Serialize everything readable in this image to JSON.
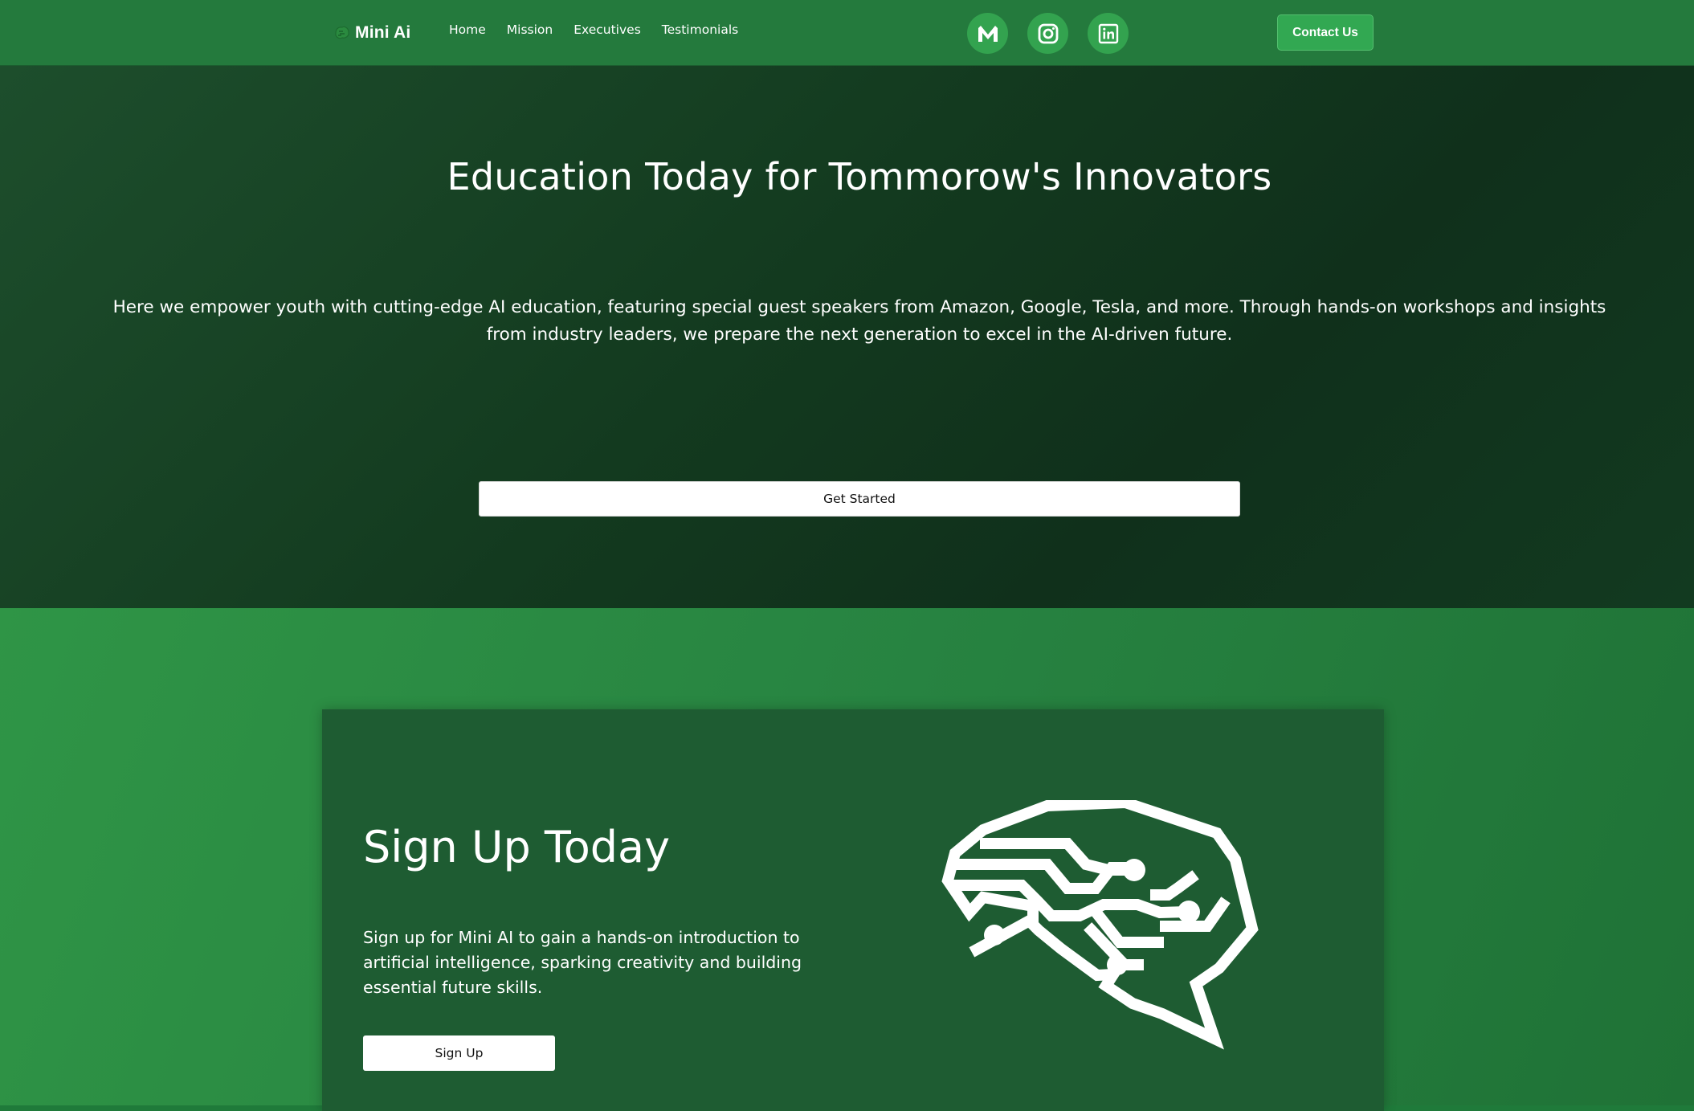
{
  "navbar": {
    "brand": "Mini Ai",
    "links": [
      "Home",
      "Mission",
      "Executives",
      "Testimonials"
    ],
    "socials": [
      "medium-icon",
      "instagram-icon",
      "linkedin-icon"
    ],
    "contact_label": "Contact Us"
  },
  "hero": {
    "title": "Education Today for Tommorow's Innovators",
    "description": "Here we empower youth with cutting-edge AI education, featuring special guest speakers from Amazon, Google, Tesla, and more. Through hands-on workshops and insights from industry leaders, we prepare the next generation to excel in the AI-driven future.",
    "cta_label": "Get Started"
  },
  "signup": {
    "title": "Sign Up Today",
    "description": "Sign up for Mini AI to gain a hands-on introduction to artificial intelligence, sparking creativity and building essential future skills.",
    "button_label": "Sign Up",
    "illustration": "brain-circuit-icon"
  },
  "colors": {
    "nav_bg": "#247a3d",
    "hero_bg": "#133a1f",
    "accent": "#32a852",
    "card_bg": "#1e5c32"
  }
}
